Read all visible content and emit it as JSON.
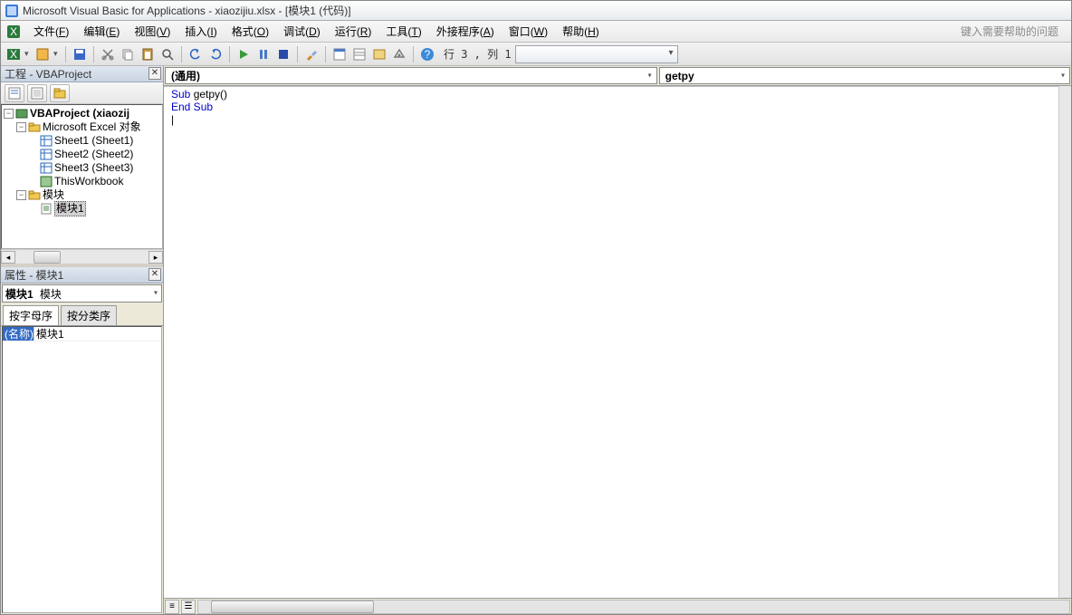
{
  "titlebar": {
    "title": "Microsoft Visual Basic for Applications - xiaozijiu.xlsx - [模块1 (代码)]"
  },
  "menu": {
    "file": {
      "label": "文件(",
      "hot": "F",
      "suffix": ")"
    },
    "edit": {
      "label": "编辑(",
      "hot": "E",
      "suffix": ")"
    },
    "view": {
      "label": "视图(",
      "hot": "V",
      "suffix": ")"
    },
    "insert": {
      "label": "插入(",
      "hot": "I",
      "suffix": ")"
    },
    "format": {
      "label": "格式(",
      "hot": "O",
      "suffix": ")"
    },
    "debug": {
      "label": "调试(",
      "hot": "D",
      "suffix": ")"
    },
    "run": {
      "label": "运行(",
      "hot": "R",
      "suffix": ")"
    },
    "tools": {
      "label": "工具(",
      "hot": "T",
      "suffix": ")"
    },
    "addins": {
      "label": "外接程序(",
      "hot": "A",
      "suffix": ")"
    },
    "window": {
      "label": "窗口(",
      "hot": "W",
      "suffix": ")"
    },
    "help": {
      "label": "帮助(",
      "hot": "H",
      "suffix": ")"
    },
    "searchPlaceholder": "键入需要帮助的问题"
  },
  "toolbar": {
    "cursor": "行 3 , 列 1"
  },
  "project": {
    "title": "工程 - VBAProject",
    "root": "VBAProject (xiaozij",
    "excelFolder": "Microsoft Excel 对象",
    "sheets": [
      "Sheet1 (Sheet1)",
      "Sheet2 (Sheet2)",
      "Sheet3 (Sheet3)"
    ],
    "thisWorkbook": "ThisWorkbook",
    "modulesFolder": "模块",
    "module1": "模块1"
  },
  "properties": {
    "title": "属性 - 模块1",
    "objectName": "模块1",
    "objectType": "模块",
    "tabAlpha": "按字母序",
    "tabCat": "按分类序",
    "nameKey": "(名称)",
    "nameVal": "模块1"
  },
  "editor": {
    "objectCombo": "(通用)",
    "procCombo": "getpy",
    "code": {
      "l1a": "Sub ",
      "l1b": "getpy()",
      "l2": "End Sub",
      "l3": "|"
    }
  }
}
